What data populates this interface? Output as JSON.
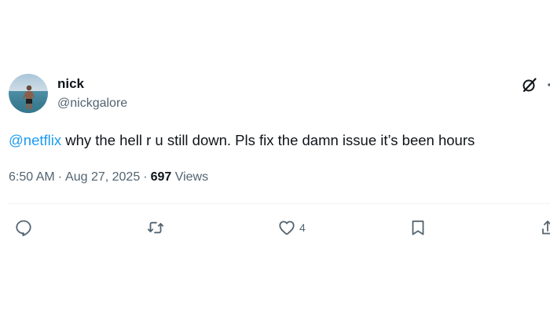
{
  "author": {
    "display_name": "nick",
    "handle": "@nickgalore"
  },
  "tweet": {
    "mention": "@netflix",
    "text": " why the hell r u still down. Pls fix the damn issue it’s been hours"
  },
  "meta": {
    "time": "6:50 AM",
    "separator": "·",
    "date": "Aug 27, 2025",
    "views_count": "697",
    "views_label": "Views"
  },
  "actions": {
    "reply_icon": "reply-icon",
    "retweet_icon": "retweet-icon",
    "like_icon": "heart-icon",
    "like_count": "4",
    "bookmark_icon": "bookmark-icon",
    "share_icon": "share-icon"
  },
  "header_icons": {
    "grok": "grok-icon",
    "more": "more-icon"
  },
  "colors": {
    "text": "#0f1419",
    "secondary": "#536471",
    "link": "#1d9bf0",
    "divider": "#eff3f4"
  }
}
